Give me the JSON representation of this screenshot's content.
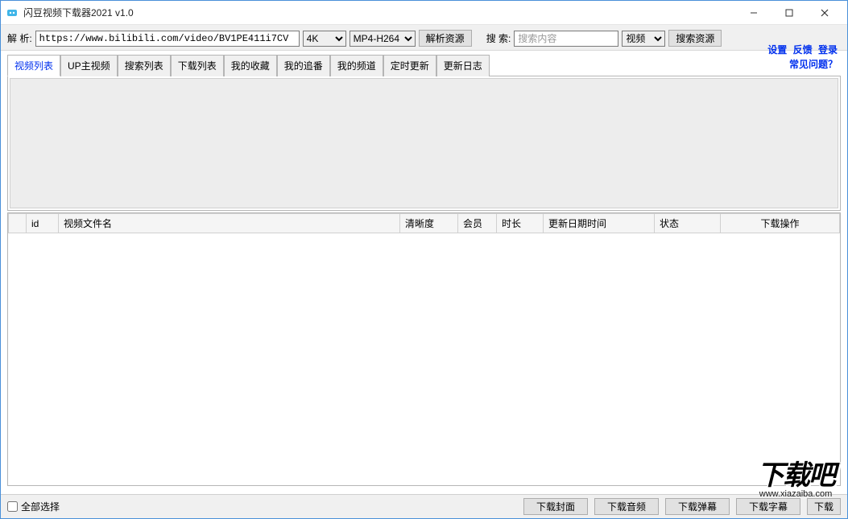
{
  "window": {
    "title": "闪豆视频下载器2021 v1.0"
  },
  "toolbar": {
    "parse_label": "解 析:",
    "url_value": "https://www.bilibili.com/video/BV1PE411i7CV",
    "quality_options": [
      "4K"
    ],
    "quality_selected": "4K",
    "format_options": [
      "MP4-H264"
    ],
    "format_selected": "MP4-H264",
    "parse_button": "解析资源",
    "search_label": "搜 索:",
    "search_placeholder": "搜索内容",
    "search_type_options": [
      "视频"
    ],
    "search_type_selected": "视频",
    "search_button": "搜索资源"
  },
  "links": {
    "settings": "设置",
    "feedback": "反馈",
    "login": "登录",
    "faq": "常见问题？"
  },
  "tabs": [
    {
      "label": "视频列表",
      "active": true
    },
    {
      "label": "UP主视频",
      "active": false
    },
    {
      "label": "搜索列表",
      "active": false
    },
    {
      "label": "下载列表",
      "active": false
    },
    {
      "label": "我的收藏",
      "active": false
    },
    {
      "label": "我的追番",
      "active": false
    },
    {
      "label": "我的频道",
      "active": false
    },
    {
      "label": "定时更新",
      "active": false
    },
    {
      "label": "更新日志",
      "active": false
    }
  ],
  "table": {
    "columns": {
      "checkbox": "",
      "id": "id",
      "name": "视频文件名",
      "quality": "清晰度",
      "vip": "会员",
      "duration": "时长",
      "date": "更新日期时间",
      "status": "状态",
      "action": "下载操作"
    },
    "rows": []
  },
  "footer": {
    "select_all": "全部选择",
    "download_cover": "下载封面",
    "download_audio": "下载音频",
    "download_danmu": "下载弹幕",
    "download_subtitle": "下载字幕",
    "download_partial": "下载"
  },
  "watermark": {
    "text": "下载吧",
    "url": "www.xiazaiba.com"
  }
}
